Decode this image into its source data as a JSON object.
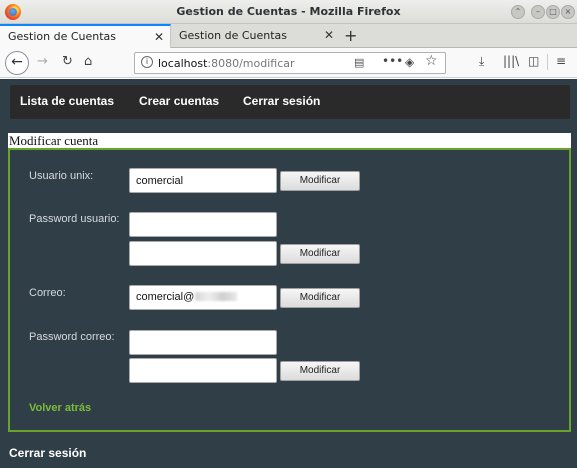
{
  "window": {
    "title": "Gestion de Cuentas - Mozilla Firefox"
  },
  "tabs": [
    {
      "label": "Gestion de Cuentas",
      "active": true
    },
    {
      "label": "Gestion de Cuentas",
      "active": false
    }
  ],
  "urlbar": {
    "host": "localhost",
    "path": ":8080/modificar"
  },
  "app_nav": {
    "items": [
      {
        "label": "Lista de cuentas"
      },
      {
        "label": "Crear cuentas"
      },
      {
        "label": "Cerrar sesión"
      }
    ]
  },
  "section_title": "Modificar cuenta",
  "form": {
    "unix_user": {
      "label": "Usuario unix:",
      "value": "comercial",
      "button": "Modificar"
    },
    "user_password": {
      "label": "Password usuario:",
      "value1": "",
      "value2": "",
      "button": "Modificar"
    },
    "email": {
      "label": "Correo:",
      "value_prefix": "comercial@",
      "button": "Modificar"
    },
    "email_password": {
      "label": "Password correo:",
      "value1": "",
      "value2": "",
      "button": "Modificar"
    },
    "back_link": "Volver atrás"
  },
  "footer": {
    "logout": "Cerrar sesión"
  },
  "colors": {
    "page_bg": "#303e48",
    "nav_bg": "#2a2a2a",
    "panel_border": "#6aa32a",
    "link_green": "#7cbb3a"
  }
}
